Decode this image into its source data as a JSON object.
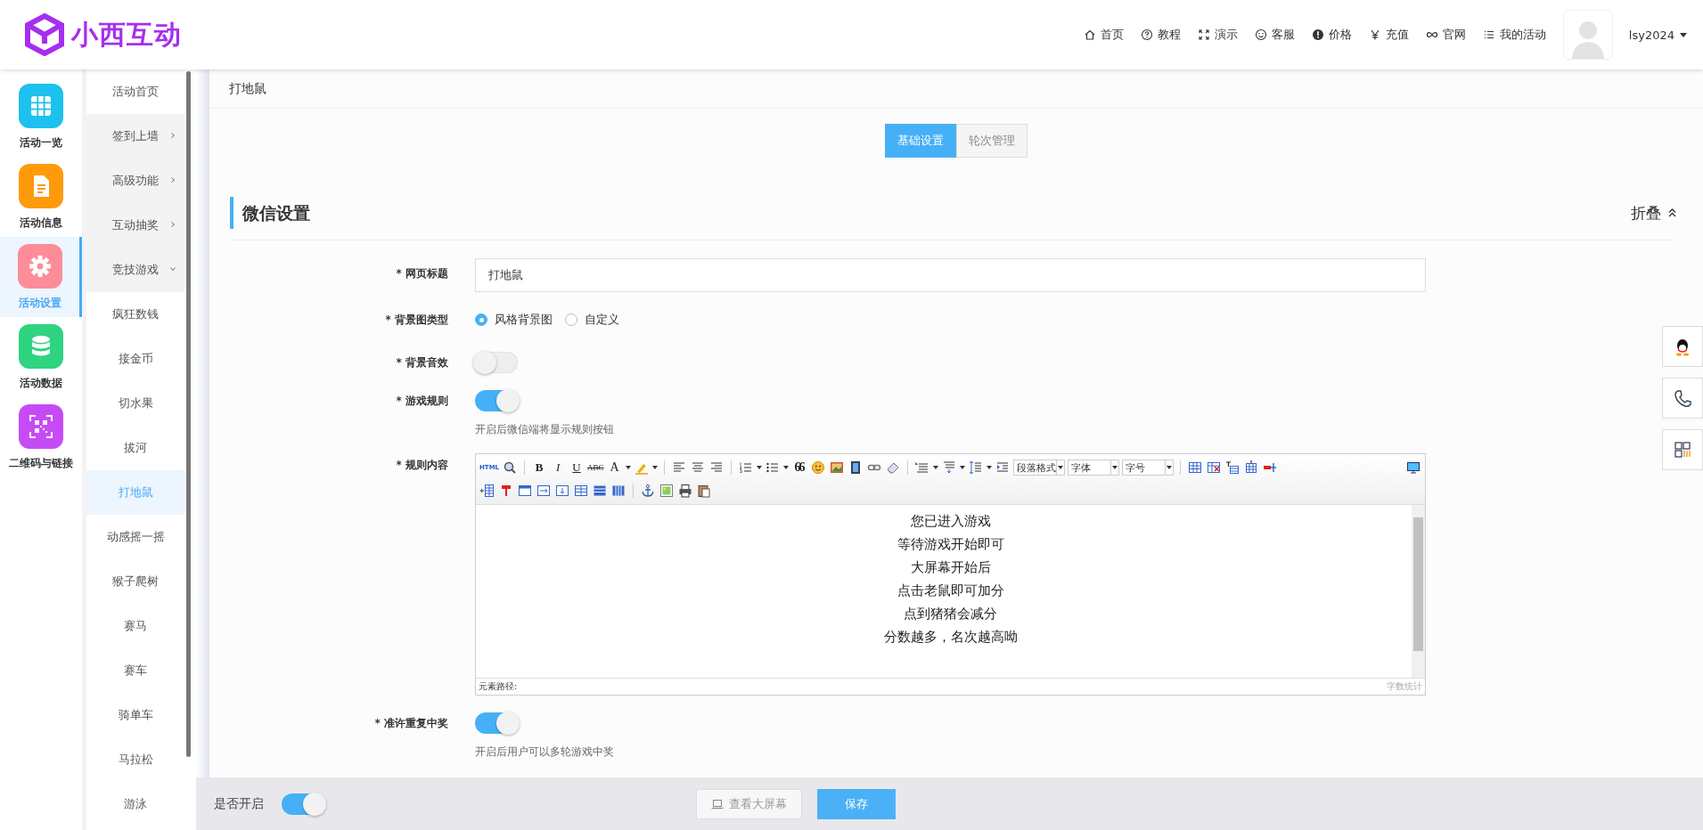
{
  "header": {
    "logo_text": "小西互动",
    "nav": [
      {
        "label": "首页",
        "kind": "home"
      },
      {
        "label": "教程",
        "kind": "help"
      },
      {
        "label": "演示",
        "kind": "fullscreen"
      },
      {
        "label": "客服",
        "kind": "smile"
      },
      {
        "label": "价格",
        "kind": "badge"
      },
      {
        "label": "充值",
        "kind": "yen"
      },
      {
        "label": "官网",
        "kind": "link"
      },
      {
        "label": "我的活动",
        "kind": "list"
      }
    ],
    "user": "lsy2024"
  },
  "sidebar": {
    "items": [
      {
        "label": "活动一览",
        "kind": "grid",
        "color": "#1cc1ee",
        "selected": false
      },
      {
        "label": "活动信息",
        "kind": "doc",
        "color": "#ff9a0a",
        "selected": false
      },
      {
        "label": "活动设置",
        "kind": "gear",
        "color": "#fc8d98",
        "selected": true
      },
      {
        "label": "活动数据",
        "kind": "db",
        "color": "#2ed47f",
        "selected": false
      },
      {
        "label": "二维码与链接",
        "kind": "qr",
        "color": "#c54cf4",
        "selected": false
      }
    ]
  },
  "submenu": {
    "items": [
      {
        "label": "活动首页",
        "kind": "link",
        "selected": false
      },
      {
        "label": "签到上墙",
        "kind": "group",
        "expanded": false
      },
      {
        "label": "高级功能",
        "kind": "group",
        "expanded": false
      },
      {
        "label": "互动抽奖",
        "kind": "group",
        "expanded": false
      },
      {
        "label": "竞技游戏",
        "kind": "group",
        "expanded": true,
        "children": [
          {
            "label": "疯狂数钱",
            "selected": false
          },
          {
            "label": "接金币",
            "selected": false
          },
          {
            "label": "切水果",
            "selected": false
          },
          {
            "label": "拔河",
            "selected": false
          },
          {
            "label": "打地鼠",
            "selected": true
          },
          {
            "label": "动感摇一摇",
            "selected": false
          },
          {
            "label": "猴子爬树",
            "selected": false
          },
          {
            "label": "赛马",
            "selected": false
          },
          {
            "label": "赛车",
            "selected": false
          },
          {
            "label": "骑单车",
            "selected": false
          },
          {
            "label": "马拉松",
            "selected": false
          },
          {
            "label": "游泳",
            "selected": false
          }
        ]
      }
    ]
  },
  "page_title": "打地鼠",
  "tabs": [
    {
      "label": "基础设置",
      "selected": true
    },
    {
      "label": "轮次管理",
      "selected": false
    }
  ],
  "section": {
    "title": "微信设置",
    "collapse": "折叠"
  },
  "form": [
    {
      "kind": "text",
      "label": "* 网页标题",
      "value": "打地鼠"
    },
    {
      "kind": "radio",
      "label": "* 背景图类型",
      "options": [
        {
          "label": "风格背景图",
          "selected": true
        },
        {
          "label": "自定义",
          "selected": false
        }
      ]
    },
    {
      "kind": "switch",
      "label": "* 背景音效",
      "on": false
    },
    {
      "kind": "switch",
      "label": "* 游戏规则",
      "on": true,
      "hint": "开启后微信端将显示规则按钮"
    },
    {
      "kind": "editor",
      "label": "* 规则内容",
      "toolbar": {
        "html_label": "HTML",
        "format_buttons": [
          "B",
          "I",
          "U",
          "ABC",
          "A"
        ],
        "quote": "66",
        "dropdowns": [
          "段落格式",
          "字体",
          "字号"
        ]
      },
      "lines": [
        "您已进入游戏",
        "等待游戏开始即可",
        "大屏幕开始后",
        "点击老鼠即可加分",
        "点到猪猪会减分",
        "分数越多，名次越高呦"
      ],
      "path_label": "元素路径:",
      "count_label": "字数统计"
    },
    {
      "kind": "switch",
      "label": "* 准许重复中奖",
      "on": true,
      "hint": "开启后用户可以多轮游戏中奖"
    }
  ],
  "footer": {
    "label": "是否开启",
    "on": true,
    "preview_button": "查看大屏幕",
    "save_button": "保存"
  }
}
